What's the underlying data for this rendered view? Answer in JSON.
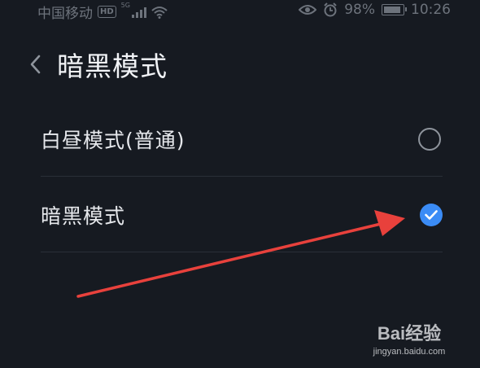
{
  "status_bar": {
    "carrier": "中国移动",
    "hd_badge": "HD",
    "network": "5G",
    "battery_percent": "98%",
    "battery_level": 0.98,
    "time": "10:26"
  },
  "header": {
    "back_icon": "chevron-left-icon",
    "title": "暗黑模式"
  },
  "options": [
    {
      "label": "白昼模式(普通)",
      "selected": false
    },
    {
      "label": "暗黑模式",
      "selected": true
    }
  ],
  "colors": {
    "background": "#161a21",
    "accent": "#3b8cf6",
    "annotation_arrow": "#e8413c"
  },
  "watermark": {
    "logo": "Bai经验",
    "url": "jingyan.baidu.com"
  }
}
